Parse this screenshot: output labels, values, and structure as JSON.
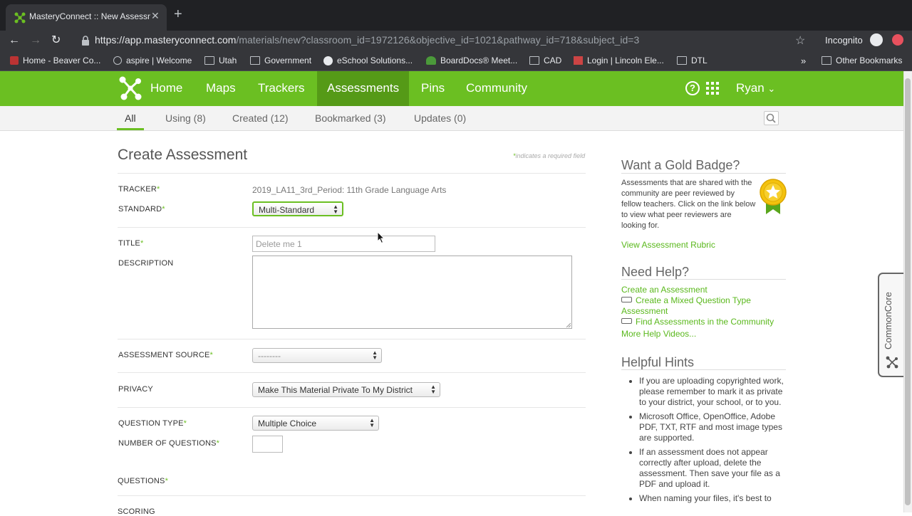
{
  "browser": {
    "tab_title": "MasteryConnect :: New Assessment",
    "url_host": "https://app.masteryconnect.com",
    "url_path": "/materials/new?classroom_id=1972126&objective_id=1021&pathway_id=718&subject_id=3",
    "incognito_label": "Incognito",
    "bookmarks": [
      {
        "label": "Home - Beaver Co...",
        "icon": "site-icon"
      },
      {
        "label": "aspire | Welcome",
        "icon": "site-icon"
      },
      {
        "label": "Utah",
        "icon": "folder-icon"
      },
      {
        "label": "Government",
        "icon": "folder-icon"
      },
      {
        "label": "eSchool Solutions...",
        "icon": "site-icon"
      },
      {
        "label": "BoardDocs® Meet...",
        "icon": "site-icon"
      },
      {
        "label": "CAD",
        "icon": "folder-icon"
      },
      {
        "label": "Login | Lincoln Ele...",
        "icon": "site-icon"
      },
      {
        "label": "DTL",
        "icon": "folder-icon"
      }
    ],
    "bookmarks_overflow": "»",
    "other_bookmarks": "Other Bookmarks"
  },
  "site_nav": {
    "items": [
      "Home",
      "Maps",
      "Trackers",
      "Assessments",
      "Pins",
      "Community"
    ],
    "active": "Assessments",
    "user": "Ryan",
    "brand_color": "#6bbf22"
  },
  "subnav": {
    "tabs": [
      "All",
      "Using (8)",
      "Created (12)",
      "Bookmarked (3)",
      "Updates (0)"
    ]
  },
  "form": {
    "heading": "Create Assessment",
    "required_note": "indicates a required field",
    "required_mark": "*",
    "tracker_label": "TRACKER",
    "tracker_value": "2019_LA11_3rd_Period: 11th Grade Language Arts",
    "standard_label": "STANDARD",
    "standard_value": "Multi-Standard",
    "title_label": "TITLE",
    "title_placeholder": "Delete me 1",
    "description_label": "DESCRIPTION",
    "source_label": "ASSESSMENT SOURCE",
    "source_value": "--------",
    "privacy_label": "PRIVACY",
    "privacy_value": "Make This Material Private To My District",
    "qtype_label": "QUESTION TYPE",
    "qtype_value": "Multiple Choice",
    "numq_label": "NUMBER OF QUESTIONS",
    "questions_label": "QUESTIONS",
    "scoring_label": "SCORING"
  },
  "sidebar": {
    "gold_heading": "Want a Gold Badge?",
    "gold_text": "Assessments that are shared with the community are peer reviewed by fellow teachers. Click on the link below to view what peer reviewers are looking for.",
    "rubric_link": "View Assessment Rubric",
    "help_heading": "Need Help?",
    "help_links": [
      "Create an Assessment",
      "Create a Mixed Question Type Assessment",
      "Find Assessments in the Community",
      "More Help Videos..."
    ],
    "hints_heading": "Helpful Hints",
    "hints": [
      "If you are uploading copyrighted work, please remember to mark it as private to your district, your school, or to you.",
      "Microsoft Office, OpenOffice, Adobe PDF, TXT, RTF and most image types are supported.",
      "If an assessment does not appear correctly after upload, delete the assessment. Then save your file as a PDF and upload it.",
      "When naming your files, it's best to"
    ]
  },
  "side_tab": {
    "label": "CommonCore"
  }
}
